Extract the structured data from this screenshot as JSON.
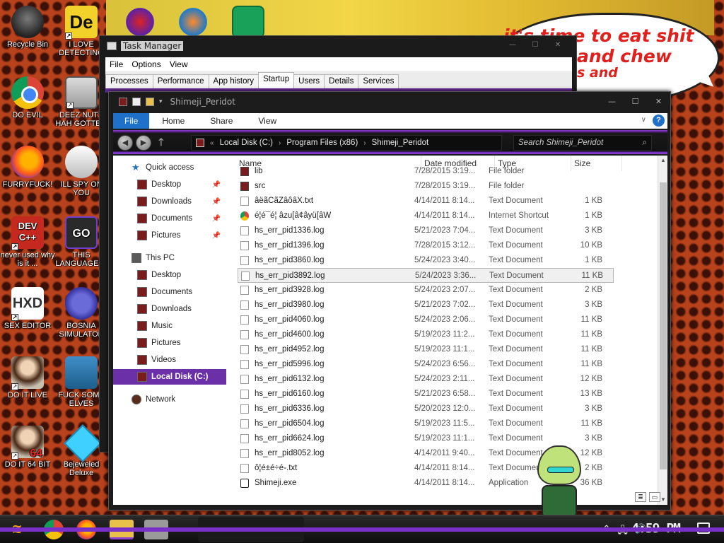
{
  "desktop": {
    "speech_bubble": {
      "line1": "it's time to eat shit",
      "line2": "and chew",
      "line3": "s and"
    },
    "icons": [
      {
        "label": "Recycle Bin",
        "icon": "recycle-bin-icon"
      },
      {
        "label": "I LOVE DETECTING",
        "icon": "detective-app-icon"
      },
      {
        "label": "DO EVIL",
        "icon": "chrome-icon"
      },
      {
        "label": "DEEZ NUTS HAH GOTTEM",
        "icon": "windows-app-icon"
      },
      {
        "label": "FURRYFUCK!",
        "icon": "firefox-icon"
      },
      {
        "label": "ILL SPY ON YOU",
        "icon": "spy-app-icon"
      },
      {
        "label": "never used why is it ...",
        "icon": "devcpp-icon"
      },
      {
        "label": "THIS LANGUAGE ...",
        "icon": "go-language-icon"
      },
      {
        "label": "SEX EDITOR",
        "icon": "hxd-editor-icon"
      },
      {
        "label": "BOSNIA SIMULATOR",
        "icon": "bosnia-game-icon"
      },
      {
        "label": "DO IT LIVE",
        "icon": "portrait-icon"
      },
      {
        "label": "FUCK SOME ELVES",
        "icon": "elves-game-icon"
      },
      {
        "label": "DO IT 64 BIT",
        "icon": "portrait-64-icon"
      },
      {
        "label": "Bejeweled Deluxe",
        "icon": "gem-icon"
      }
    ],
    "top_icons": [
      "app-icon-red",
      "app-icon-orange",
      "app-icon-green"
    ],
    "de_glyph": "De",
    "devcpp_glyph": "DEV C++",
    "go_glyph": "GO",
    "hxd_glyph": "HXD",
    "bit64_glyph": "64"
  },
  "task_manager": {
    "title": "Task Manager",
    "menu": [
      "File",
      "Options",
      "View"
    ],
    "tabs": [
      "Processes",
      "Performance",
      "App history",
      "Startup",
      "Users",
      "Details",
      "Services"
    ],
    "active_tab": "Startup"
  },
  "explorer": {
    "title": "Shimeji_Peridot",
    "ribbon": {
      "file": "File",
      "tabs": [
        "Home",
        "Share",
        "View"
      ],
      "help": "?"
    },
    "address": [
      "Local Disk (C:)",
      "Program Files (x86)",
      "Shimeji_Peridot"
    ],
    "search_placeholder": "Search Shimeji_Peridot",
    "nav": {
      "quick_access": "Quick access",
      "quick_items": [
        "Desktop",
        "Downloads",
        "Documents",
        "Pictures"
      ],
      "this_pc": "This PC",
      "pc_items": [
        "Desktop",
        "Documents",
        "Downloads",
        "Music",
        "Pictures",
        "Videos",
        "Local Disk (C:)"
      ],
      "network": "Network",
      "selected": "Local Disk (C:)"
    },
    "columns": {
      "name": "Name",
      "date": "Date modified",
      "type": "Type",
      "size": "Size"
    },
    "files": [
      {
        "name": "lib",
        "date": "7/28/2015 3:19...",
        "type": "File folder",
        "size": "",
        "kind": "folder"
      },
      {
        "name": "src",
        "date": "7/28/2015 3:19...",
        "type": "File folder",
        "size": "",
        "kind": "folder"
      },
      {
        "name": "âëãCãZâôâX.txt",
        "date": "4/14/2011 8:14...",
        "type": "Text Document",
        "size": "1 KB",
        "kind": "txt"
      },
      {
        "name": "é¦é¯é¦ âzu[â¢âyü[âW",
        "date": "4/14/2011 8:14...",
        "type": "Internet Shortcut",
        "size": "1 KB",
        "kind": "url"
      },
      {
        "name": "hs_err_pid1336.log",
        "date": "5/21/2023 7:04...",
        "type": "Text Document",
        "size": "3 KB",
        "kind": "txt"
      },
      {
        "name": "hs_err_pid1396.log",
        "date": "7/28/2015 3:12...",
        "type": "Text Document",
        "size": "10 KB",
        "kind": "txt"
      },
      {
        "name": "hs_err_pid3860.log",
        "date": "5/24/2023 3:40...",
        "type": "Text Document",
        "size": "1 KB",
        "kind": "txt"
      },
      {
        "name": "hs_err_pid3892.log",
        "date": "5/24/2023 3:36...",
        "type": "Text Document",
        "size": "11 KB",
        "kind": "txt"
      },
      {
        "name": "hs_err_pid3928.log",
        "date": "5/24/2023 2:07...",
        "type": "Text Document",
        "size": "2 KB",
        "kind": "txt"
      },
      {
        "name": "hs_err_pid3980.log",
        "date": "5/21/2023 7:02...",
        "type": "Text Document",
        "size": "3 KB",
        "kind": "txt"
      },
      {
        "name": "hs_err_pid4060.log",
        "date": "5/24/2023 2:06...",
        "type": "Text Document",
        "size": "11 KB",
        "kind": "txt"
      },
      {
        "name": "hs_err_pid4600.log",
        "date": "5/19/2023 11:2...",
        "type": "Text Document",
        "size": "11 KB",
        "kind": "txt"
      },
      {
        "name": "hs_err_pid4952.log",
        "date": "5/19/2023 11:1...",
        "type": "Text Document",
        "size": "11 KB",
        "kind": "txt"
      },
      {
        "name": "hs_err_pid5996.log",
        "date": "5/24/2023 6:56...",
        "type": "Text Document",
        "size": "11 KB",
        "kind": "txt"
      },
      {
        "name": "hs_err_pid6132.log",
        "date": "5/24/2023 2:11...",
        "type": "Text Document",
        "size": "12 KB",
        "kind": "txt"
      },
      {
        "name": "hs_err_pid6160.log",
        "date": "5/21/2023 6:58...",
        "type": "Text Document",
        "size": "13 KB",
        "kind": "txt"
      },
      {
        "name": "hs_err_pid6336.log",
        "date": "5/20/2023 12:0...",
        "type": "Text Document",
        "size": "3 KB",
        "kind": "txt"
      },
      {
        "name": "hs_err_pid6504.log",
        "date": "5/19/2023 11:5...",
        "type": "Text Document",
        "size": "11 KB",
        "kind": "txt"
      },
      {
        "name": "hs_err_pid6624.log",
        "date": "5/19/2023 11:1...",
        "type": "Text Document",
        "size": "3 KB",
        "kind": "txt"
      },
      {
        "name": "hs_err_pid8052.log",
        "date": "4/14/2011 9:40...",
        "type": "Text Document",
        "size": "12 KB",
        "kind": "txt"
      },
      {
        "name": "ô¦é±é÷é-.txt",
        "date": "4/14/2011 8:14...",
        "type": "Text Document",
        "size": "2 KB",
        "kind": "txt"
      },
      {
        "name": "Shimeji.exe",
        "date": "4/14/2011 8:14...",
        "type": "Application",
        "size": "36 KB",
        "kind": "exe"
      }
    ],
    "hover_file": "hs_err_pid3892.log"
  },
  "taskbar": {
    "clock": "4:59 PM",
    "pinned": [
      "start-button",
      "chrome-icon",
      "firefox-icon",
      "file-explorer-icon",
      "task-manager-icon"
    ]
  },
  "colors": {
    "accent_purple": "#6b2fa8",
    "ribbon_blue": "#1f70c8",
    "desktop_orange": "#b8421c"
  }
}
